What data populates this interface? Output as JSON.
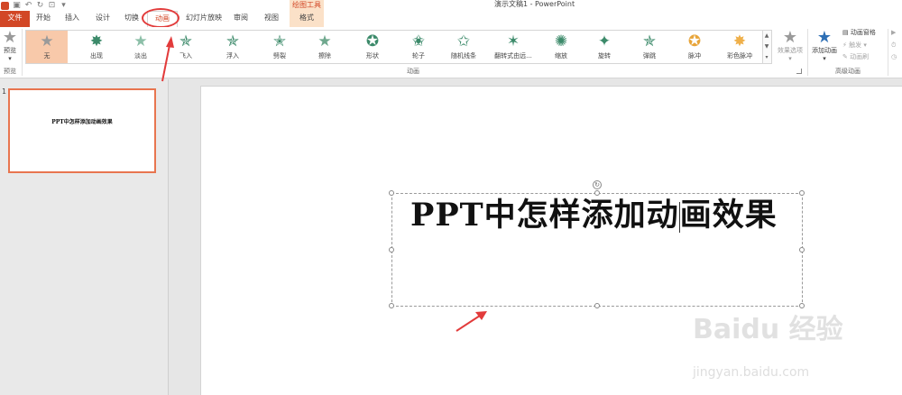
{
  "window": {
    "title": "演示文稿1 - PowerPoint",
    "context_group": "绘图工具"
  },
  "colors": {
    "accent": "#d24726",
    "anim_star": "#3c8a6a",
    "highlight": "#f8c9aa",
    "annotation": "#e23b3b"
  },
  "tabs": [
    {
      "label": "文件",
      "icon": null
    },
    {
      "label": "开始"
    },
    {
      "label": "插入"
    },
    {
      "label": "设计"
    },
    {
      "label": "切换"
    },
    {
      "label": "动画"
    },
    {
      "label": "幻灯片放映"
    },
    {
      "label": "审阅"
    },
    {
      "label": "视图"
    },
    {
      "label": "格式"
    }
  ],
  "ribbon": {
    "preview": {
      "button_label": "预览",
      "group_label": "预览"
    },
    "animations": {
      "group_label": "动画",
      "items": [
        {
          "label": "无",
          "icon": "star-none-icon",
          "selected": true
        },
        {
          "label": "出现",
          "icon": "star-appear-icon"
        },
        {
          "label": "淡出",
          "icon": "star-fade-icon"
        },
        {
          "label": "飞入",
          "icon": "star-fly-in-icon"
        },
        {
          "label": "浮入",
          "icon": "star-float-in-icon"
        },
        {
          "label": "劈裂",
          "icon": "star-split-icon"
        },
        {
          "label": "擦除",
          "icon": "star-wipe-icon"
        },
        {
          "label": "形状",
          "icon": "star-shape-icon"
        },
        {
          "label": "轮子",
          "icon": "star-wheel-icon"
        },
        {
          "label": "随机线条",
          "icon": "star-random-bars-icon"
        },
        {
          "label": "翻转式由远...",
          "icon": "star-grow-turn-icon"
        },
        {
          "label": "缩放",
          "icon": "star-zoom-icon"
        },
        {
          "label": "旋转",
          "icon": "star-swivel-icon"
        },
        {
          "label": "弹跳",
          "icon": "star-bounce-icon"
        },
        {
          "label": "脉冲",
          "icon": "star-pulse-icon"
        },
        {
          "label": "彩色脉冲",
          "icon": "star-color-pulse-icon"
        }
      ],
      "effect_options": "效果选项"
    },
    "advanced": {
      "group_label": "高级动画",
      "add_animation": "添加动画",
      "animation_pane": "动画窗格",
      "trigger": "触发",
      "animation_painter": "动画刷"
    }
  },
  "slides_pane": {
    "slide_number": "1",
    "thumb_title": "PPT中怎样添加动画效果"
  },
  "slide": {
    "title": "PPT中怎样添加动画效果"
  },
  "watermark": {
    "brand": "Baidu 经验",
    "url": "jingyan.baidu.com"
  }
}
